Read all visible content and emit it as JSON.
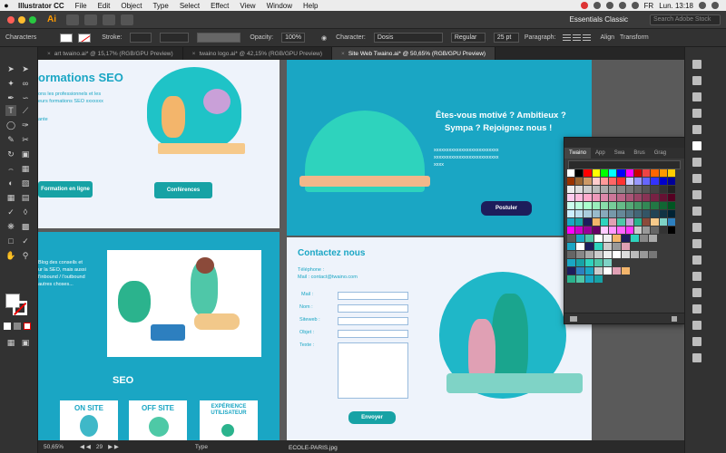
{
  "menubar": {
    "apple": "",
    "app_name": "Illustrator CC",
    "items": [
      "File",
      "Edit",
      "Object",
      "Type",
      "Select",
      "Effect",
      "View",
      "Window",
      "Help"
    ],
    "language": "FR",
    "clock": "Lun. 13:18"
  },
  "appbar": {
    "logo": "Ai",
    "workspace": "Essentials Classic",
    "search_placeholder": "Search Adobe Stock"
  },
  "controlbar": {
    "selection": "Characters",
    "stroke_label": "Stroke:",
    "opacity_label": "Opacity:",
    "opacity_value": "100%",
    "character_label": "Character:",
    "font_name": "Dosis",
    "font_style": "Regular",
    "font_size": "25 pt",
    "paragraph_label": "Paragraph:",
    "align_label": "Align",
    "transform_label": "Transform"
  },
  "doctabs": [
    {
      "label": "art twaino.ai* @ 15,17% (RGB/GPU Preview)",
      "active": false
    },
    {
      "label": "twaino logo.ai* @ 42,15% (RGB/GPU Preview)",
      "active": false
    },
    {
      "label": "Site Web Twaino.ai* @ 50,65% (RGB/GPU Preview)",
      "active": true
    }
  ],
  "artboard_left": {
    "title": "ormations SEO",
    "desc": [
      "ons les professionnels et les",
      "eurs formations SEO xxxxxxx"
    ],
    "desc_tail": "ante",
    "btn_online": "Formation en ligne",
    "btn_conferences": "Conférences",
    "blog_text": [
      "Blog des conseils et",
      "ur la SEO, mais aussi",
      "l'inbound / l'outbound",
      "autres choses..."
    ],
    "seo_heading": "SEO",
    "cards": [
      "ON SITE",
      "OFF SITE",
      "EXPÉRIENCE UTILISATEUR"
    ]
  },
  "artboard_right": {
    "hero_line1": "Êtes-vous motivé ? Ambitieux ?",
    "hero_line2": "Sympa ? Rejoignez nous !",
    "hero_placeholder": [
      "xxxxxxxxxxxxxxxxxxxxxxxxxx",
      "xxxxxxxxxxxxxxxxxxxxxxxxxx",
      "xxxx"
    ],
    "btn_postuler": "Postuler",
    "contact_title": "Contactez nous",
    "phone": "Téléphone :",
    "mail": "Mail : contact@twaino.com",
    "form_labels": [
      "Mail :",
      "Nom :",
      "Siteweb :",
      "Objet :",
      "Texte :"
    ],
    "btn_envoyer": "Envoyer"
  },
  "swatches_panel": {
    "tabs": [
      "Twaino",
      "App",
      "Swa",
      "Brus",
      "Grag"
    ]
  },
  "statusbar": {
    "zoom": "50,65%",
    "page": "29",
    "tool": "Type"
  },
  "file_label": "ECOLE-PARIS.jpg",
  "colors": {
    "teal": "#1aa6c4",
    "navy": "#1d1d5b",
    "button_teal": "#17a2a5",
    "illustrator_orange": "#ff9a00"
  }
}
